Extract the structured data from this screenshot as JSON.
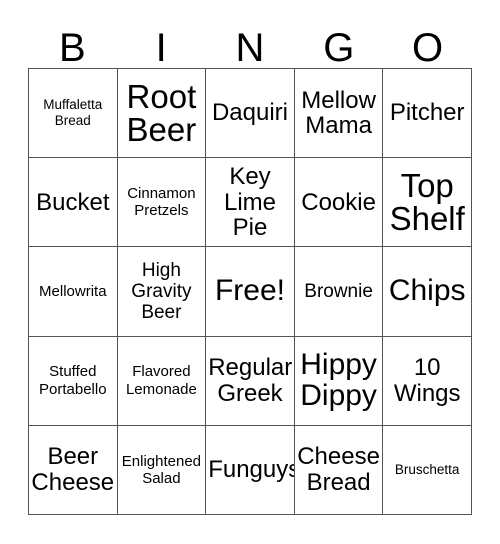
{
  "card": {
    "title": "BINGO",
    "header_letters": [
      "B",
      "I",
      "N",
      "G",
      "O"
    ],
    "free_space_label": "Free!",
    "colors": {
      "background": "#ffffff",
      "text": "#000000",
      "grid_line": "#555555"
    },
    "grid_size": "5x5",
    "rows": [
      [
        {
          "label": "Muffaletta Bread",
          "size": "xs"
        },
        {
          "label": "Root Beer",
          "size": "xxl"
        },
        {
          "label": "Daquiri",
          "size": "l"
        },
        {
          "label": "Mellow Mama",
          "size": "l"
        },
        {
          "label": "Pitcher",
          "size": "l"
        }
      ],
      [
        {
          "label": "Bucket",
          "size": "l"
        },
        {
          "label": "Cinnamon Pretzels",
          "size": "s"
        },
        {
          "label": "Key Lime Pie",
          "size": "l"
        },
        {
          "label": "Cookie",
          "size": "l"
        },
        {
          "label": "Top Shelf",
          "size": "xxl"
        }
      ],
      [
        {
          "label": "Mellowrita",
          "size": "s"
        },
        {
          "label": "High Gravity Beer",
          "size": "m"
        },
        {
          "label": "Free!",
          "size": "xl"
        },
        {
          "label": "Brownie",
          "size": "m"
        },
        {
          "label": "Chips",
          "size": "xl"
        }
      ],
      [
        {
          "label": "Stuffed Portabello",
          "size": "s"
        },
        {
          "label": "Flavored Lemonade",
          "size": "s"
        },
        {
          "label": "Regular Greek",
          "size": "l"
        },
        {
          "label": "Hippy Dippy",
          "size": "xl"
        },
        {
          "label": "10 Wings",
          "size": "l"
        }
      ],
      [
        {
          "label": "Beer Cheese",
          "size": "l"
        },
        {
          "label": "Enlightened Salad",
          "size": "s"
        },
        {
          "label": "Funguys",
          "size": "l"
        },
        {
          "label": "Cheese Bread",
          "size": "l"
        },
        {
          "label": "Bruschetta",
          "size": "xs"
        }
      ]
    ]
  }
}
